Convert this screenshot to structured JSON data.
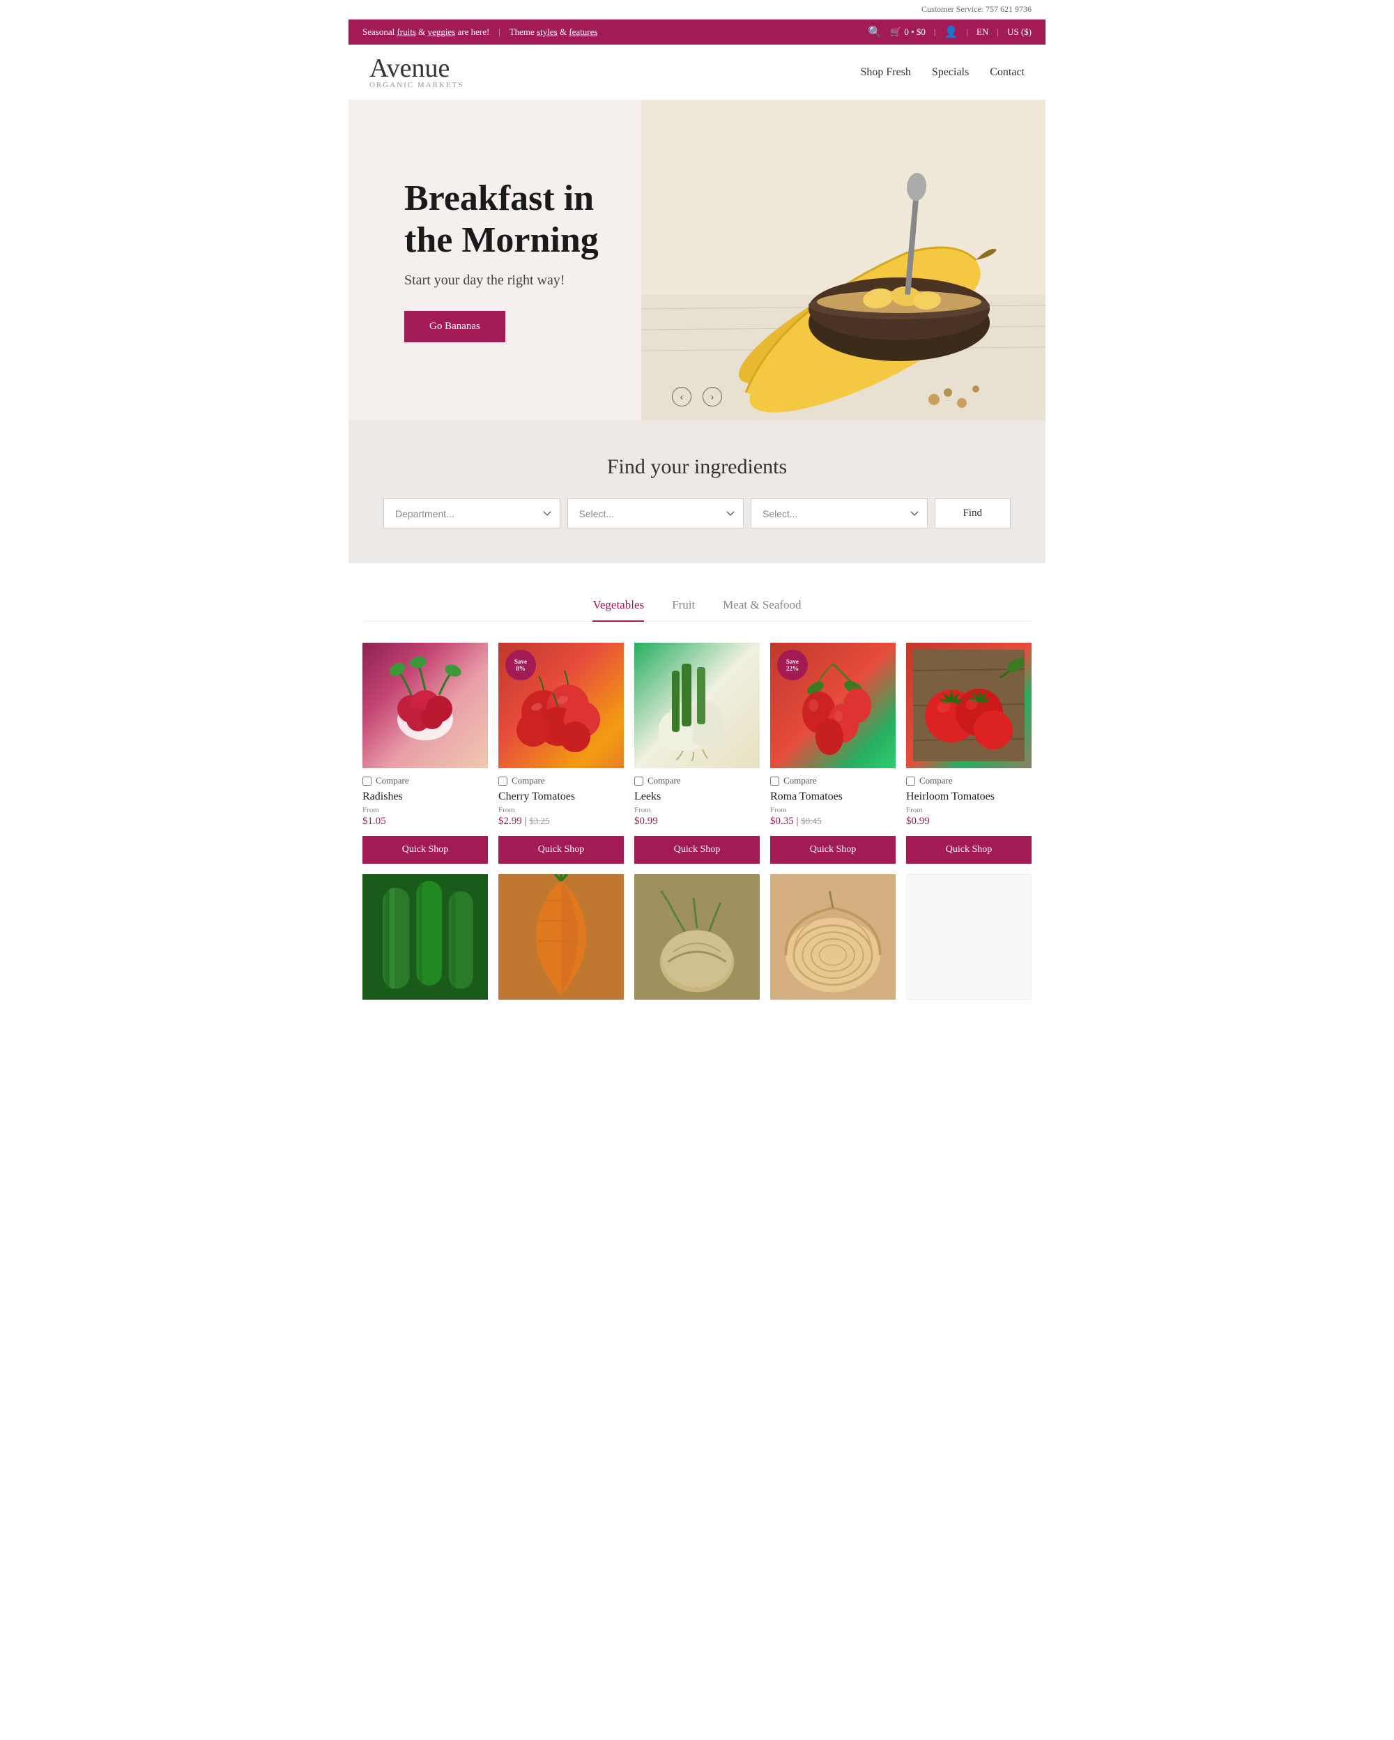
{
  "customer_service": "Customer Service: 757 621 9736",
  "announcement": {
    "text": "Seasonal ",
    "fruits": "fruits",
    "and": " & ",
    "veggies": "veggies",
    "text2": " are here!",
    "separator": "|",
    "theme": "Theme ",
    "styles": "styles",
    "and2": " & ",
    "features": "features"
  },
  "cart": {
    "label": "0 • $0"
  },
  "lang": "EN",
  "currency": "US ($)",
  "logo": {
    "name": "Avenue",
    "sub": "organic markets"
  },
  "nav": {
    "shop_fresh": "Shop Fresh",
    "specials": "Specials",
    "contact": "Contact"
  },
  "hero": {
    "title": "Breakfast in the Morning",
    "subtitle": "Start your day the right way!",
    "button": "Go Bananas"
  },
  "search_section": {
    "title": "Find your ingredients",
    "department_placeholder": "Department...",
    "select1_placeholder": "Select...",
    "select2_placeholder": "Select...",
    "find_btn": "Find"
  },
  "category_tabs": [
    {
      "label": "Vegetables",
      "active": true
    },
    {
      "label": "Fruit",
      "active": false
    },
    {
      "label": "Meat & Seafood",
      "active": false
    }
  ],
  "products": [
    {
      "name": "Radishes",
      "from_label": "From",
      "price": "$1.05",
      "original_price": null,
      "save": null,
      "img_class": "img-radishes",
      "quick_shop": "Quick Shop"
    },
    {
      "name": "Cherry Tomatoes",
      "from_label": "From",
      "price": "$2.99",
      "original_price": "$3.25",
      "save": "Save 8%",
      "img_class": "img-cherry-tomatoes",
      "quick_shop": "Quick Shop"
    },
    {
      "name": "Leeks",
      "from_label": "From",
      "price": "$0.99",
      "original_price": null,
      "save": null,
      "img_class": "img-leeks",
      "quick_shop": "Quick Shop"
    },
    {
      "name": "Roma Tomatoes",
      "from_label": "From",
      "price": "$0.35",
      "original_price": "$0.45",
      "save": "Save 22%",
      "img_class": "img-roma-tomatoes",
      "quick_shop": "Quick Shop"
    },
    {
      "name": "Heirloom Tomatoes",
      "from_label": "From",
      "price": "$0.99",
      "original_price": null,
      "save": null,
      "img_class": "img-heirloom-tomatoes",
      "quick_shop": "Quick Shop"
    }
  ],
  "products_row2": [
    {
      "img_class": "img-cucumber"
    },
    {
      "img_class": "img-carrot"
    },
    {
      "img_class": "img-fennel"
    },
    {
      "img_class": "img-onion"
    },
    {
      "img_class": "img-white-box"
    }
  ],
  "compare_label": "Compare",
  "accent_color": "#a31b55"
}
